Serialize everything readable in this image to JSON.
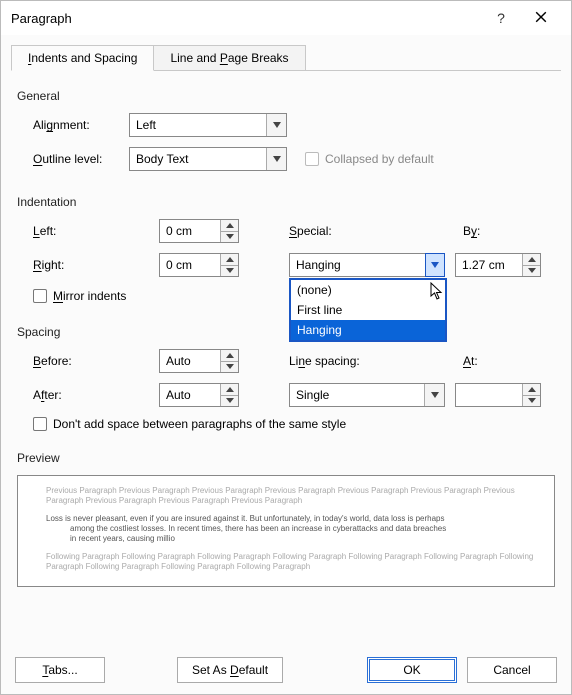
{
  "dialog": {
    "title": "Paragraph"
  },
  "titlebar": {
    "help_tooltip": "?",
    "close_tooltip": "Close"
  },
  "tabs": {
    "active": "Indents and Spacing",
    "other": "Line and Page Breaks"
  },
  "general": {
    "header": "General",
    "alignment_label": "Alignment:",
    "alignment_value": "Left",
    "outline_label": "Outline level:",
    "outline_value": "Body Text",
    "collapsed_label": "Collapsed by default"
  },
  "indentation": {
    "header": "Indentation",
    "left_label": "Left:",
    "left_value": "0 cm",
    "right_label": "Right:",
    "right_value": "0 cm",
    "special_label": "Special:",
    "special_value": "Hanging",
    "special_options": [
      "(none)",
      "First line",
      "Hanging"
    ],
    "by_label": "By:",
    "by_value": "1.27 cm",
    "mirror_label": "Mirror indents"
  },
  "spacing": {
    "header": "Spacing",
    "before_label": "Before:",
    "before_value": "Auto",
    "after_label": "After:",
    "after_value": "Auto",
    "line_spacing_label": "Line spacing:",
    "line_spacing_value": "Single",
    "at_label": "At:",
    "at_value": "",
    "dont_add_label": "Don't add space between paragraphs of the same style"
  },
  "preview": {
    "header": "Preview",
    "prev_para": "Previous Paragraph Previous Paragraph Previous Paragraph Previous Paragraph Previous Paragraph Previous Paragraph Previous Paragraph Previous Paragraph Previous Paragraph Previous Paragraph",
    "body_l1": "Loss is never pleasant, even if you are insured against it. But unfortunately, in today's world, data loss is perhaps",
    "body_l2": "among the costliest losses. In recent times, there has been an increase in cyberattacks and data breaches",
    "body_l3": "in recent years, causing millio",
    "follow_para": "Following Paragraph Following Paragraph Following Paragraph Following Paragraph Following Paragraph Following Paragraph Following Paragraph Following Paragraph Following Paragraph Following Paragraph"
  },
  "buttons": {
    "tabs": "Tabs...",
    "set_default": "Set As Default",
    "ok": "OK",
    "cancel": "Cancel"
  }
}
